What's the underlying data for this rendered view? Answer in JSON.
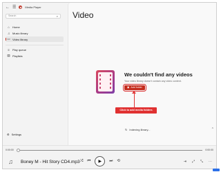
{
  "window": {
    "title": "Media Player"
  },
  "titlebar": {
    "back_icon": "back-arrow",
    "minimize_glyph": "—",
    "maximize_glyph": "☐",
    "close_glyph": "✕"
  },
  "sidebar": {
    "search_placeholder": "Search",
    "items": [
      {
        "label": "Home",
        "icon": "⌂"
      },
      {
        "label": "Music library",
        "icon": "♫"
      },
      {
        "label": "Video library",
        "icon": "▭"
      },
      {
        "label": "Play queue",
        "icon": "≡"
      },
      {
        "label": "Playlists",
        "icon": "▤"
      }
    ],
    "settings_label": "Settings",
    "settings_icon": "⚙"
  },
  "content": {
    "title": "Video",
    "empty_heading": "We couldn't find any videos",
    "empty_sub": "Your video library doesn't contain any video content.",
    "add_folder_label": "Add folder",
    "callout_label": "Click to add media folders",
    "indexing_label": "Indexing library..."
  },
  "player": {
    "time_start": "0:00:00",
    "time_end": "0:00:00",
    "progress": 0,
    "track_title": "Boney M - Hit Story CD4.mp3",
    "right_controls": [
      "⇥",
      "⤢",
      "⤡",
      "⋯"
    ]
  },
  "colors": {
    "accent": "#c42b1c",
    "callout": "#e03131"
  }
}
